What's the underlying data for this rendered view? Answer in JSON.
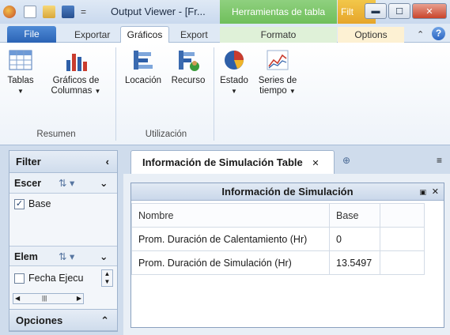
{
  "titlebar": {
    "title": "Output Viewer - [Fr...",
    "context_tab_table": "Herramientas de tabla",
    "context_tab_filter": "Filt",
    "separator": "="
  },
  "tabs": {
    "file": "File",
    "exportar": "Exportar",
    "graficos": "Gráficos",
    "export": "Export",
    "formato": "Formato",
    "options": "Options"
  },
  "ribbon": {
    "tablas": "Tablas",
    "graficos_line1": "Gráficos de",
    "graficos_line2": "Columnas",
    "resumen": "Resumen",
    "locacion": "Locación",
    "recurso": "Recurso",
    "utilizacion": "Utilización",
    "estado": "Estado",
    "series_line1": "Series de",
    "series_line2": "tiempo"
  },
  "left_pane": {
    "filter_title": "Filter",
    "escenario_label": "Escer",
    "escenario_item": "Base",
    "elementos_label": "Elem",
    "elementos_item": "Fecha Ejecu",
    "opciones_title": "Opciones"
  },
  "document": {
    "tab_title": "Información de Simulación Table",
    "panel_title": "Información de Simulación",
    "columns": [
      "Nombre",
      "Base"
    ],
    "rows": [
      {
        "name": "Prom. Duración de Calentamiento (Hr)",
        "value": "0"
      },
      {
        "name": "Prom. Duración de Simulación (Hr)",
        "value": "13.5497"
      }
    ]
  }
}
